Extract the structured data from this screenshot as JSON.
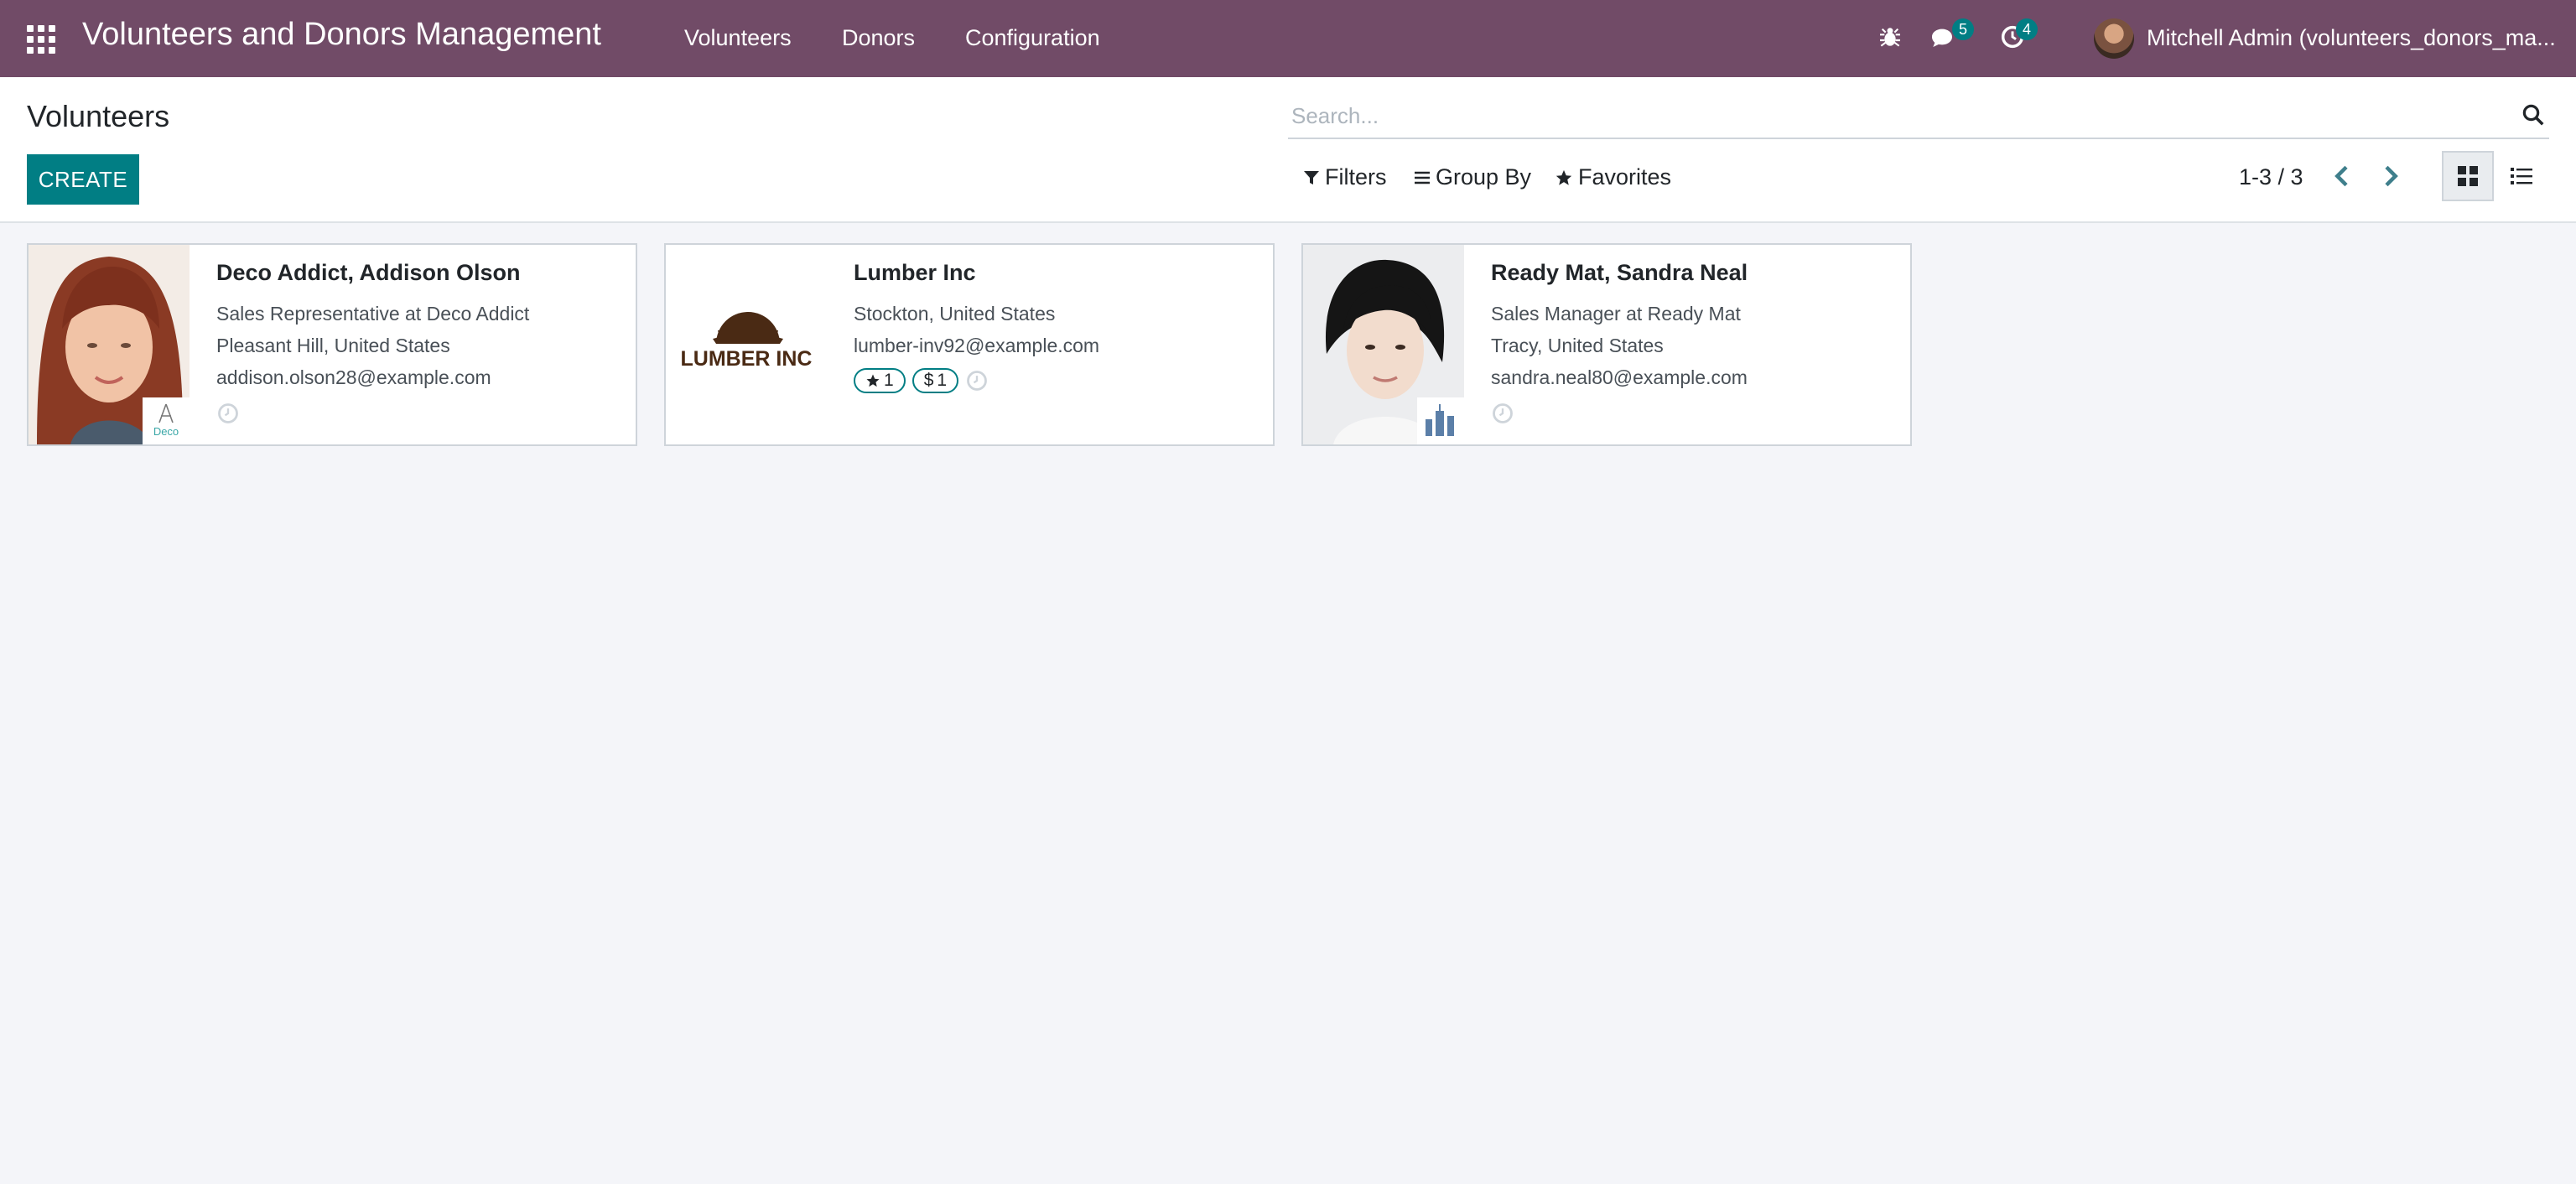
{
  "navbar": {
    "app_title": "Volunteers and Donors Management",
    "menus": [
      "Volunteers",
      "Donors",
      "Configuration"
    ],
    "messages_count": "5",
    "activities_count": "4",
    "user_name": "Mitchell Admin (volunteers_donors_ma..."
  },
  "control_panel": {
    "title": "Volunteers",
    "create_label": "CREATE",
    "search_placeholder": "Search...",
    "filters_label": "Filters",
    "groupby_label": "Group By",
    "favorites_label": "Favorites",
    "pager": "1-3 / 3"
  },
  "cards": [
    {
      "name": "Deco Addict, Addison Olson",
      "job": "Sales Representative at Deco Addict",
      "location": "Pleasant Hill, United States",
      "email": "addison.olson28@example.com",
      "company_logo_text": "Deco"
    },
    {
      "name": "Lumber Inc",
      "location": "Stockton, United States",
      "email": "lumber-inv92@example.com",
      "logo_text": "LUMBER INC",
      "tags": [
        "1",
        "1"
      ]
    },
    {
      "name": "Ready Mat, Sandra Neal",
      "job": "Sales Manager at Ready Mat",
      "location": "Tracy, United States",
      "email": "sandra.neal80@example.com"
    }
  ],
  "colors": {
    "navbar": "#714b67",
    "primary": "#017e84",
    "background": "#f4f5f9"
  }
}
